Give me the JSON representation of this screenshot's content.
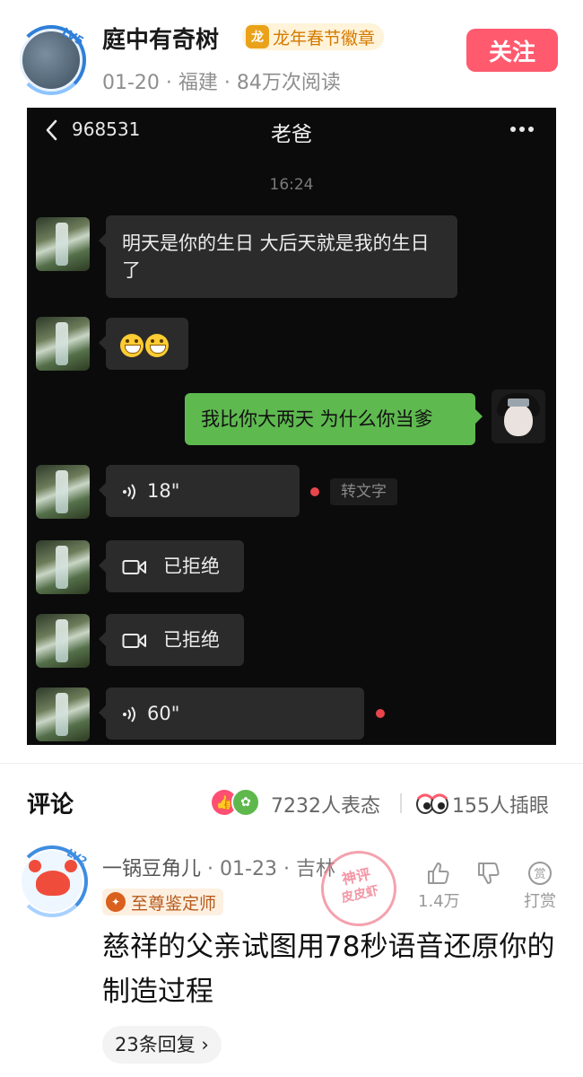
{
  "post": {
    "author_name": "庭中有奇树",
    "author_level": "LV5",
    "badge_label": "龙年春节徽章",
    "meta": "01-20 · 福建 · 84万次阅读",
    "follow_label": "关注"
  },
  "chat": {
    "header_id": "968531",
    "header_title": "老爸",
    "time": "16:24",
    "messages": [
      {
        "from": "other",
        "type": "text",
        "text": "明天是你的生日 大后天就是我的生日了"
      },
      {
        "from": "other",
        "type": "emoji",
        "emoji": "grin-emoji x2"
      },
      {
        "from": "me",
        "type": "text",
        "text": "我比你大两天 为什么你当爹"
      },
      {
        "from": "other",
        "type": "voice",
        "duration": "18\"",
        "unread": true,
        "action": "转文字"
      },
      {
        "from": "other",
        "type": "video-call",
        "text": "已拒绝"
      },
      {
        "from": "other",
        "type": "video-call",
        "text": "已拒绝"
      },
      {
        "from": "other",
        "type": "voice",
        "duration": "60\"",
        "unread": true
      }
    ]
  },
  "comments": {
    "title": "评论",
    "reactions_text": "7232人表态",
    "eye_text": "155人插眼",
    "items": [
      {
        "user": "一锅豆角儿",
        "user_level": "LV2",
        "date": "01-23",
        "location": "吉林",
        "role": "至尊鉴定师",
        "text": "慈祥的父亲试图用78秒语音还原你的制造过程",
        "likes": "1.4万",
        "tip_label": "打赏",
        "tip_icon_char": "赏",
        "replies": "23条回复",
        "stamp_line1": "神评",
        "stamp_line2": "皮皮虾"
      }
    ]
  },
  "colors": {
    "follow": "#ff5a6e",
    "chat_bg": "#0b0b0b",
    "my_bubble": "#5eb94f",
    "other_bubble": "#2b2b2b",
    "unread_dot": "#e8454b"
  }
}
